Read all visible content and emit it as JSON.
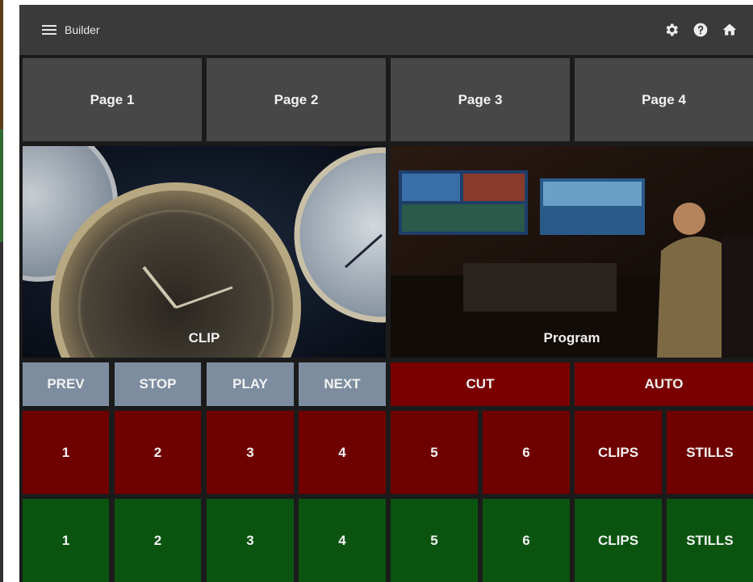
{
  "app": {
    "title": "Builder"
  },
  "toolbar": {
    "icons": [
      "gear-icon",
      "help-icon",
      "home-icon"
    ]
  },
  "pages": [
    "Page 1",
    "Page 2",
    "Page 3",
    "Page 4"
  ],
  "viewers": {
    "left_label": "CLIP",
    "right_label": "Program"
  },
  "controls": {
    "prev": "PREV",
    "stop": "STOP",
    "play": "PLAY",
    "next": "NEXT",
    "cut": "CUT",
    "auto": "AUTO"
  },
  "red_row": [
    "1",
    "2",
    "3",
    "4",
    "5",
    "6",
    "CLIPS",
    "STILLS"
  ],
  "green_row": [
    "1",
    "2",
    "3",
    "4",
    "5",
    "6",
    "CLIPS",
    "STILLS"
  ],
  "colors": {
    "topbar": "#3a3a3a",
    "page_tab": "#474747",
    "control": "#7d8d9f",
    "red_bar": "#7a0000",
    "red": "#6f0000",
    "green": "#0b5410"
  }
}
